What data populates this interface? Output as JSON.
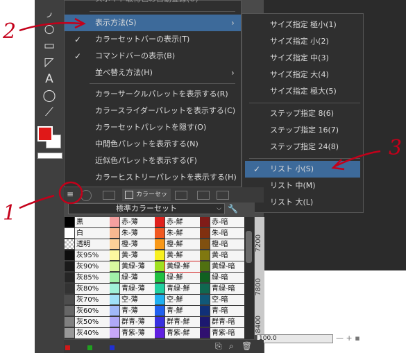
{
  "top_cut_item": "スポイト取得色の自動登録(U)",
  "main_menu": [
    {
      "label": "表示方法(S)",
      "has_submenu": true,
      "highlighted": true,
      "checked": false
    },
    {
      "label": "カラーセットバーの表示(T)",
      "checked": true
    },
    {
      "label": "コマンドバーの表示(B)",
      "checked": true
    },
    {
      "label": "並べ替え方法(H)",
      "has_submenu": true
    },
    {
      "label": "カラーサークルパレットを表示する(R)"
    },
    {
      "label": "カラースライダーパレットを表示する(C)"
    },
    {
      "label": "カラーセットパレットを隠す(O)"
    },
    {
      "label": "中間色パレットを表示する(N)"
    },
    {
      "label": "近似色パレットを表示する(F)"
    },
    {
      "label": "カラーヒストリーパレットを表示する(H)"
    }
  ],
  "submenu": [
    {
      "label": "サイズ指定 極小(1)"
    },
    {
      "label": "サイズ指定 小(2)"
    },
    {
      "label": "サイズ指定 中(3)"
    },
    {
      "label": "サイズ指定 大(4)"
    },
    {
      "label": "サイズ指定 極大(5)"
    },
    {
      "label": "ステップ指定 8(6)"
    },
    {
      "label": "ステップ指定 16(7)"
    },
    {
      "label": "ステップ指定 24(8)"
    },
    {
      "label": "リスト 小(S)",
      "checked": true,
      "highlighted": true
    },
    {
      "label": "リスト 中(M)"
    },
    {
      "label": "リスト 大(L)"
    }
  ],
  "palette_tab_label": "カラーセット",
  "color_set_name": "標準カラーセット",
  "palette": [
    [
      {
        "n": "黒",
        "c": "#000000"
      },
      {
        "n": "赤-薄",
        "c": "#f4a0a0"
      },
      {
        "n": "赤-鮮",
        "c": "#e0201c"
      },
      {
        "n": "赤-暗",
        "c": "#801c18"
      }
    ],
    [
      {
        "n": "白",
        "c": "#ffffff"
      },
      {
        "n": "朱-薄",
        "c": "#f8b890"
      },
      {
        "n": "朱-鮮",
        "c": "#f05820"
      },
      {
        "n": "朱-暗",
        "c": "#803010"
      }
    ],
    [
      {
        "n": "透明",
        "c": "checker"
      },
      {
        "n": "橙-薄",
        "c": "#fcd098"
      },
      {
        "n": "橙-鮮",
        "c": "#f89818"
      },
      {
        "n": "橙-暗",
        "c": "#805010"
      }
    ],
    [
      {
        "n": "灰95%",
        "c": "#0d0d0d"
      },
      {
        "n": "黄-薄",
        "c": "#fcf8a0"
      },
      {
        "n": "黄-鮮",
        "c": "#f8f020"
      },
      {
        "n": "黄-暗",
        "c": "#807810"
      }
    ],
    [
      {
        "n": "灰90%",
        "c": "#1a1a1a"
      },
      {
        "n": "黄緑-薄",
        "c": "#d8f8a0"
      },
      {
        "n": "黄緑-鮮",
        "c": "#a0e020",
        "selected": true
      },
      {
        "n": "黄緑-暗",
        "c": "#507010"
      }
    ],
    [
      {
        "n": "灰85%",
        "c": "#262626"
      },
      {
        "n": "緑-薄",
        "c": "#a0f0a8"
      },
      {
        "n": "緑-鮮",
        "c": "#20c040"
      },
      {
        "n": "緑-暗",
        "c": "#106020"
      }
    ],
    [
      {
        "n": "灰80%",
        "c": "#333333"
      },
      {
        "n": "青緑-薄",
        "c": "#a0f0d8"
      },
      {
        "n": "青緑-鮮",
        "c": "#20d0a0"
      },
      {
        "n": "青緑-暗",
        "c": "#106850"
      }
    ],
    [
      {
        "n": "灰70%",
        "c": "#4d4d4d"
      },
      {
        "n": "空-薄",
        "c": "#a0e0f8"
      },
      {
        "n": "空-鮮",
        "c": "#20b0f0"
      },
      {
        "n": "空-暗",
        "c": "#105878"
      }
    ],
    [
      {
        "n": "灰60%",
        "c": "#666666"
      },
      {
        "n": "青-薄",
        "c": "#a0b8f8"
      },
      {
        "n": "青-鮮",
        "c": "#2060f0"
      },
      {
        "n": "青-暗",
        "c": "#103078"
      }
    ],
    [
      {
        "n": "灰50%",
        "c": "#808080"
      },
      {
        "n": "群青-薄",
        "c": "#b0a8f8"
      },
      {
        "n": "群青-鮮",
        "c": "#3830e0"
      },
      {
        "n": "群青-暗",
        "c": "#1c1870"
      }
    ],
    [
      {
        "n": "灰40%",
        "c": "#999999"
      },
      {
        "n": "青紫-薄",
        "c": "#c8a8f8"
      },
      {
        "n": "青紫-鮮",
        "c": "#6020e0"
      },
      {
        "n": "青紫-暗",
        "c": "#301070"
      }
    ]
  ],
  "ruler_labels": [
    "7200",
    "7800",
    "8400"
  ],
  "zoom": "100.0",
  "annotations": [
    "1",
    "2",
    "3"
  ],
  "colors": {
    "menu_bg": "#2f2f2f",
    "highlight": "#3d6a9a",
    "annotation": "#c4001a",
    "fg_color": "#e01818"
  }
}
